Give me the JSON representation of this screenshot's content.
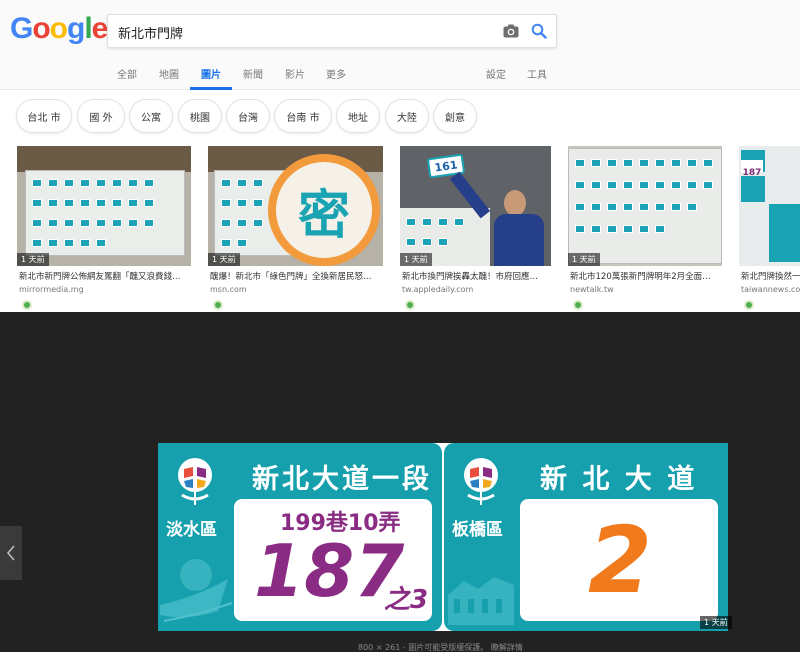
{
  "logo": [
    "G",
    "o",
    "o",
    "g",
    "l",
    "e"
  ],
  "search": {
    "value": "新北市門牌"
  },
  "tabs": [
    {
      "label": "全部"
    },
    {
      "label": "地圖"
    },
    {
      "label": "圖片"
    },
    {
      "label": "新聞"
    },
    {
      "label": "影片"
    },
    {
      "label": "更多"
    },
    {
      "label": "設定"
    },
    {
      "label": "工具"
    }
  ],
  "chips": [
    "台北 市",
    "國 外",
    "公寓",
    "桃園",
    "台灣",
    "台南 市",
    "地址",
    "大陸",
    "創意"
  ],
  "thumbs": [
    {
      "time": "1 天前",
      "title": "新北市新門牌公佈網友罵翻「醜又浪費錢…",
      "source": "mirrormedia.mg"
    },
    {
      "time": "1 天前",
      "title": "醜爆！新北市「綠色門牌」全換新居民怒…",
      "source": "msn.com",
      "overlay": "密"
    },
    {
      "time": "1 天前",
      "title": "新北市換門牌挨轟太醜！市府回應…",
      "source": "tw.appledaily.com",
      "sign": "161"
    },
    {
      "time": "1 天前",
      "title": "新北市120萬張新門牌明年2月全面…",
      "source": "newtalk.tw"
    },
    {
      "time": "",
      "title": "新北門牌換然一",
      "source": "taiwannews.com",
      "sign": "187"
    }
  ],
  "preview": {
    "left": {
      "district": "淡水區",
      "road": "新北大道一段",
      "lane": "199巷10弄",
      "number": "187",
      "sub": "之3"
    },
    "right": {
      "district": "板橋區",
      "road": "新 北 大 道",
      "number": "2"
    },
    "time": "1 天前",
    "info": "800 × 261 - 圖片可能受版權保護。 瞭解詳情"
  },
  "colors": {
    "plate_teal": "#16a0ae",
    "number_purple": "#8a2c83",
    "number_orange": "#f07a1c"
  }
}
